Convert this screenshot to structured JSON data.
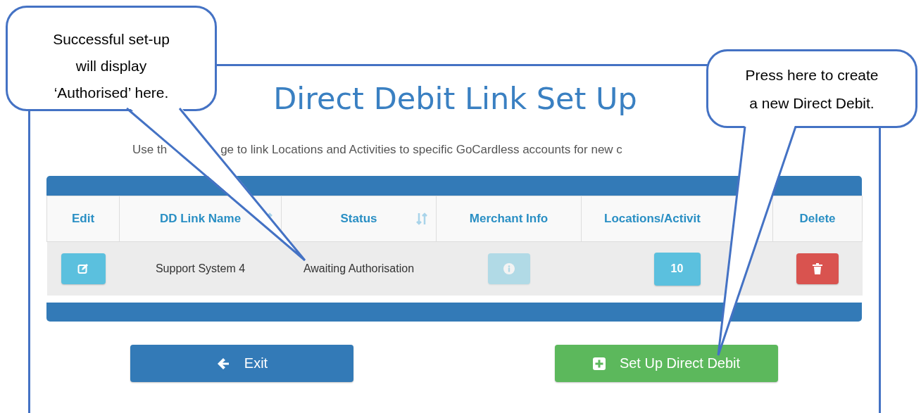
{
  "callouts": [
    {
      "lines": [
        "Successful set-up",
        "will display",
        "‘Authorised’ here."
      ]
    },
    {
      "lines": [
        "Press here to create",
        "a new Direct Debit."
      ]
    }
  ],
  "page": {
    "title": "Direct Debit Link Set Up",
    "subtitle_parts": [
      "Use th",
      "ge to link Locations and Activities to specific GoCardless accounts for new c"
    ]
  },
  "table": {
    "columns": [
      {
        "label": "Edit",
        "sortable": false
      },
      {
        "label": "DD Link Name",
        "sortable": true
      },
      {
        "label": "Status",
        "sortable": true
      },
      {
        "label": "Merchant Info",
        "sortable": false
      },
      {
        "label": "Locations/Activit"
      },
      {
        "label": "Delete",
        "sortable": false
      }
    ],
    "rows": [
      {
        "cells": [
          {
            "kind": "edit"
          },
          {
            "kind": "text",
            "text": "Support System 4"
          },
          {
            "kind": "text",
            "text": "Awaiting Authorisation"
          },
          {
            "kind": "info",
            "disabled": true
          },
          {
            "kind": "count",
            "text": "10"
          },
          {
            "kind": "delete"
          }
        ]
      }
    ]
  },
  "buttons": [
    {
      "kind": "back",
      "label": "Exit"
    },
    {
      "kind": "add",
      "label": "Set Up Direct Debit"
    }
  ]
}
